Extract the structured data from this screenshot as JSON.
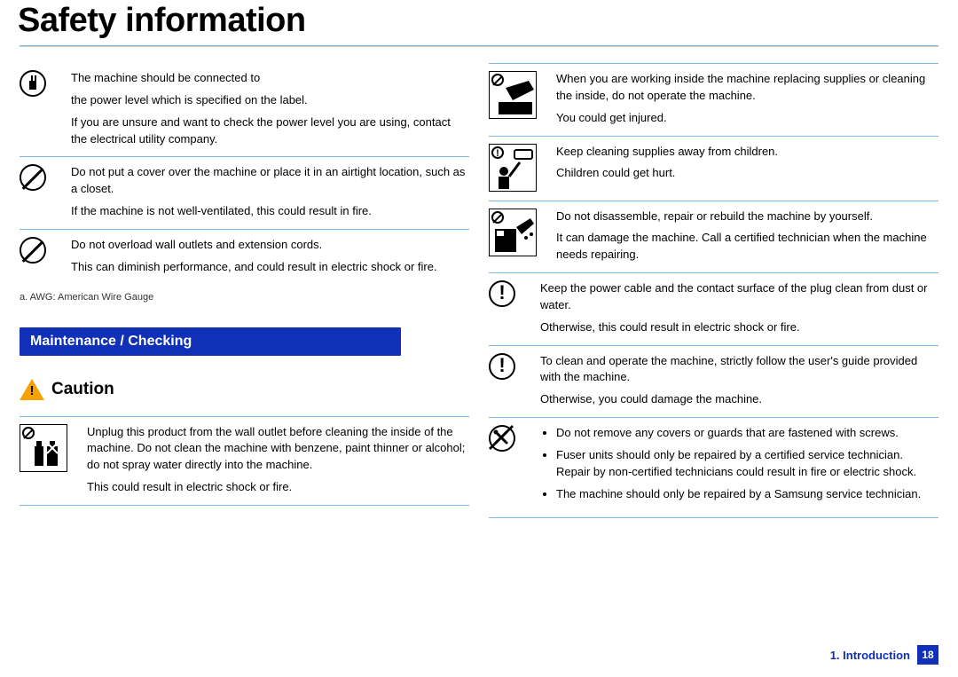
{
  "page_title": "Safety information",
  "left": {
    "rows": [
      {
        "line1": "The machine should be connected to",
        "line2": "the power level which is specified on the label.",
        "line3": "If you are unsure and want to check the power level you are using, contact the electrical utility company."
      },
      {
        "line1": "Do not put a cover over the machine or place it in an airtight location, such as a closet.",
        "line2": "If the machine is not well-ventilated, this could result in fire."
      },
      {
        "line1": "Do not overload wall outlets and extension cords.",
        "line2": "This can diminish performance, and could result in electric shock or fire."
      }
    ],
    "footnote": "a.  AWG: American Wire Gauge",
    "section_bar": "Maintenance / Checking",
    "caution_label": "Caution",
    "caution_row": {
      "line1": "Unplug this product from the wall outlet before cleaning the inside of the machine. Do not clean the machine with benzene, paint thinner or alcohol; do not spray water directly into the machine.",
      "line2": "This could result in electric shock or fire."
    }
  },
  "right": {
    "rows": [
      {
        "line1": "When you are working inside the machine replacing supplies or cleaning the inside, do not operate the machine.",
        "line2": "You could get injured."
      },
      {
        "line1": "Keep cleaning supplies away from children.",
        "line2": "Children could get hurt."
      },
      {
        "line1": "Do not disassemble, repair or rebuild the machine by yourself.",
        "line2": "It can damage the machine. Call a certified technician when the machine needs repairing."
      },
      {
        "line1": "Keep the power cable and the contact surface of the plug clean from dust or water.",
        "line2": "Otherwise, this could result in electric shock or fire."
      },
      {
        "line1": "To clean and operate the machine, strictly follow the user's guide provided with the machine.",
        "line2": "Otherwise, you could damage the machine."
      }
    ],
    "bullets": {
      "b1": "Do not remove any covers or guards that are fastened with screws.",
      "b2": "Fuser units should only be repaired by a certified service technician. Repair by non-certified technicians could result in fire or electric shock.",
      "b3": "The machine should only be repaired by a Samsung service technician."
    }
  },
  "footer": {
    "chapter": "1.  Introduction",
    "page": "18"
  }
}
